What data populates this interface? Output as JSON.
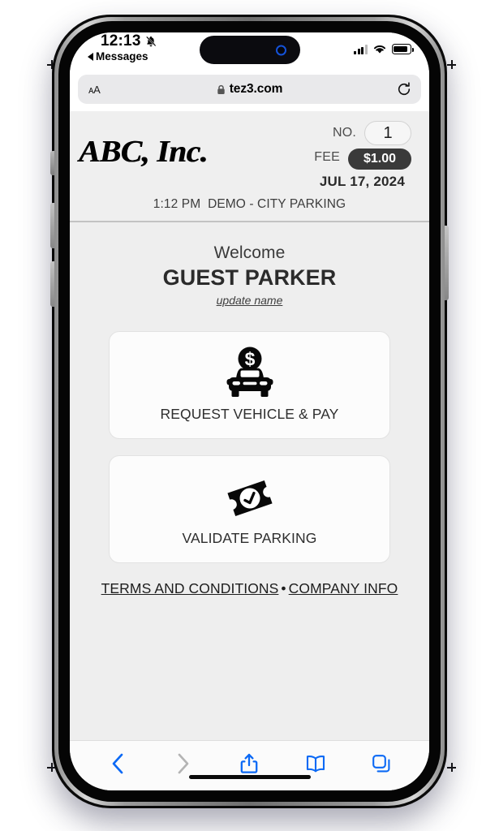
{
  "status_bar": {
    "time": "12:13",
    "silent_icon": "bell-slash-icon",
    "back_label": "Messages",
    "signal_icon": "cellular-signal-icon",
    "wifi_icon": "wifi-icon",
    "battery_icon": "battery-icon"
  },
  "browser": {
    "text_size_label": "AA",
    "lock_icon": "lock-icon",
    "url": "tez3.com",
    "reload_icon": "reload-icon",
    "toolbar": {
      "back": "back-chevron-icon",
      "forward": "forward-chevron-icon",
      "share": "share-icon",
      "bookmarks": "book-icon",
      "tabs": "tabs-icon"
    }
  },
  "ticket_header": {
    "company_logo": "ABC, Inc.",
    "number_label": "NO.",
    "number_value": "1",
    "fee_label": "FEE",
    "fee_value": "$1.00",
    "date": "JUL 17, 2024",
    "sub_time": "1:12 PM",
    "sub_location": "DEMO - CITY PARKING"
  },
  "welcome": {
    "greeting": "Welcome",
    "name": "GUEST PARKER",
    "update_link": "update name"
  },
  "actions": [
    {
      "label": "REQUEST VEHICLE & PAY",
      "icon": "car-with-dollar-icon"
    },
    {
      "label": "VALIDATE PARKING",
      "icon": "ticket-check-icon"
    }
  ],
  "footer": {
    "terms": "TERMS AND CONDITIONS",
    "separator": "•",
    "company": "COMPANY INFO"
  },
  "colors": {
    "page_bg": "#eeeeee",
    "header_bg": "#efefef",
    "fee_pill": "#3a3a3a",
    "accent_blue": "#0b69f5",
    "card_bg": "#fcfcfc"
  }
}
